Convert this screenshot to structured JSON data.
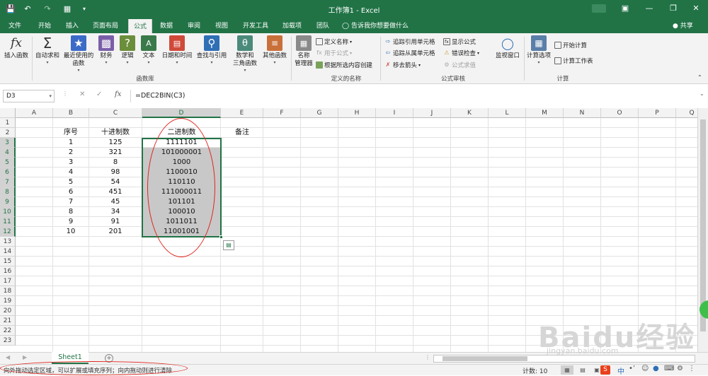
{
  "window": {
    "title": "工作簿1 - Excel",
    "user": "共享",
    "qat_icons": [
      "save-icon",
      "undo-icon",
      "redo-icon",
      "form-icon",
      "customize-icon"
    ]
  },
  "tabs": [
    "文件",
    "开始",
    "插入",
    "页面布局",
    "公式",
    "数据",
    "审阅",
    "视图",
    "开发工具",
    "加载项",
    "团队"
  ],
  "active_tab": "公式",
  "search": "告诉我你想要做什么",
  "ribbon": {
    "insert_function": "插入函数",
    "autosum": "自动求和",
    "recent": "最近使用的",
    "recent2": "函数",
    "financial": "财务",
    "logical": "逻辑",
    "text": "文本",
    "datetime": "日期和时间",
    "lookup": "查找与引用",
    "math": "数学和",
    "math2": "三角函数",
    "more": "其他函数",
    "group_library": "函数库",
    "name_manager": "名称",
    "name_manager2": "管理器",
    "define_name": "定义名称",
    "use_in_formula": "用于公式",
    "create_from_selection": "根据所选内容创建",
    "group_names": "定义的名称",
    "trace_precedents": "追踪引用单元格",
    "trace_dependents": "追踪从属单元格",
    "remove_arrows": "移去箭头",
    "show_formulas": "显示公式",
    "error_checking": "错误检查",
    "evaluate_formula": "公式求值",
    "group_audit": "公式审核",
    "watch_window": "监视窗口",
    "calc_options": "计算选项",
    "calc_now": "开始计算",
    "calc_sheet": "计算工作表",
    "group_calc": "计算"
  },
  "formula_bar": {
    "name_box": "D3",
    "fx": "fx",
    "formula": "=DEC2BIN(C3)"
  },
  "columns": [
    "A",
    "B",
    "C",
    "D",
    "E",
    "F",
    "G",
    "H",
    "I",
    "J",
    "K",
    "L",
    "M",
    "N",
    "O",
    "P",
    "Q"
  ],
  "selected_column": "D",
  "rows": [
    "1",
    "2",
    "3",
    "4",
    "5",
    "6",
    "7",
    "8",
    "9",
    "10",
    "11",
    "12",
    "13",
    "14",
    "15",
    "16",
    "17",
    "18",
    "19",
    "20",
    "21",
    "22",
    "23"
  ],
  "headers": {
    "seq": "序号",
    "decimal": "十进制数",
    "binary": "二进制数",
    "note": "备注"
  },
  "table": [
    {
      "seq": "1",
      "dec": "125",
      "bin": "1111101"
    },
    {
      "seq": "2",
      "dec": "321",
      "bin": "101000001"
    },
    {
      "seq": "3",
      "dec": "8",
      "bin": "1000"
    },
    {
      "seq": "4",
      "dec": "98",
      "bin": "1100010"
    },
    {
      "seq": "5",
      "dec": "54",
      "bin": "110110"
    },
    {
      "seq": "6",
      "dec": "451",
      "bin": "111000011"
    },
    {
      "seq": "7",
      "dec": "45",
      "bin": "101101"
    },
    {
      "seq": "8",
      "dec": "34",
      "bin": "100010"
    },
    {
      "seq": "9",
      "dec": "91",
      "bin": "1011011"
    },
    {
      "seq": "10",
      "dec": "201",
      "bin": "11001001"
    }
  ],
  "sheet_tab": "Sheet1",
  "status": {
    "message": "向外拖动选定区域，可以扩展或填充序列；向内拖动则进行清除",
    "count": "计数: 10",
    "ime": "中"
  },
  "watermark": "Baidu经验",
  "watermark_url": "jingyan.baidu.com",
  "colors": {
    "excel_green": "#217346",
    "annotation_red": "#e0261f"
  }
}
